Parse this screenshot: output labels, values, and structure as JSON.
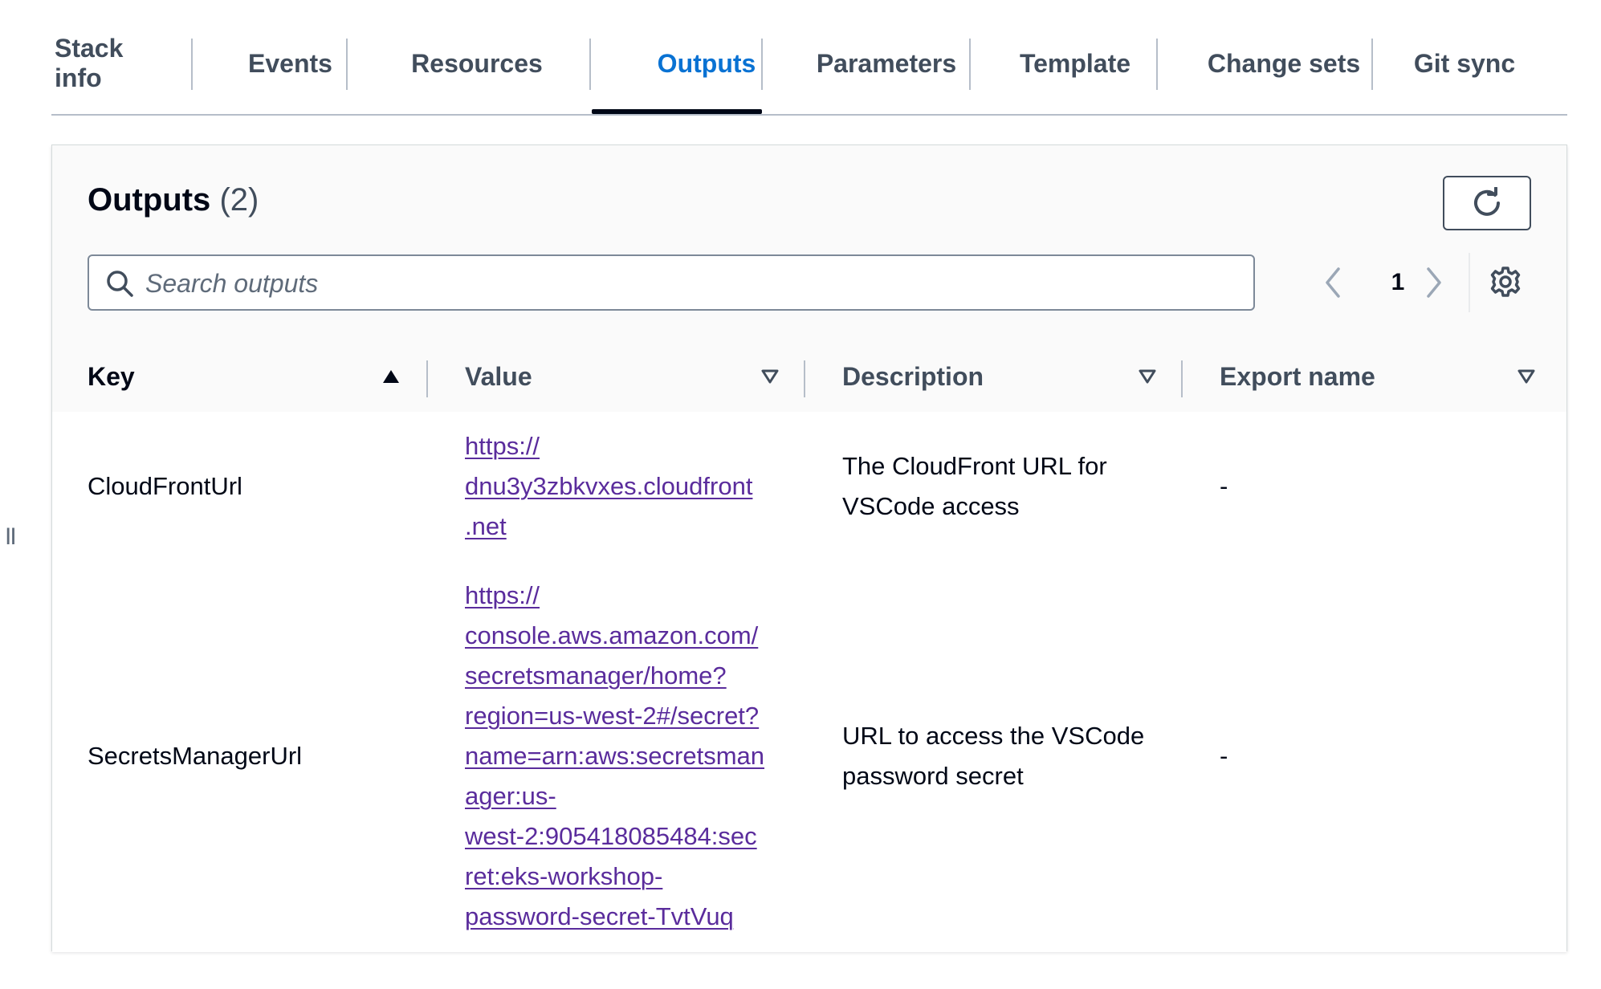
{
  "tabs": [
    {
      "label": "Stack info"
    },
    {
      "label": "Events"
    },
    {
      "label": "Resources"
    },
    {
      "label": "Outputs"
    },
    {
      "label": "Parameters"
    },
    {
      "label": "Template"
    },
    {
      "label": "Change sets"
    },
    {
      "label": "Git sync"
    }
  ],
  "active_tab": "Outputs",
  "panel": {
    "title": "Outputs",
    "count": "(2)",
    "search_placeholder": "Search outputs",
    "search_value": "",
    "page_number": "1"
  },
  "table": {
    "columns": [
      {
        "label": "Key",
        "sort": "ascending"
      },
      {
        "label": "Value",
        "sort": "none"
      },
      {
        "label": "Description",
        "sort": "none"
      },
      {
        "label": "Export name",
        "sort": "none"
      }
    ],
    "rows": [
      {
        "key": "CloudFrontUrl",
        "value": "https://\ndnu3y3zbkvxes.cloudfront\n.net",
        "description": "The CloudFront URL for\nVSCode access",
        "export_name": "-"
      },
      {
        "key": "SecretsManagerUrl",
        "value": "https://\nconsole.aws.amazon.com/\nsecretsmanager/home?\nregion=us-west-2#/secret?\nname=arn:aws:secretsman\nager:us-\nwest-2:905418085484:sec\nret:eks-workshop-\npassword-secret-TvtVuq",
        "description": "URL to access the VSCode\npassword secret",
        "export_name": "-"
      }
    ]
  },
  "side_handle": "II",
  "colors": {
    "active_tab": "#0972d3",
    "link": "#5a2c9c",
    "text": "#000716",
    "muted_text": "#414d5c",
    "border": "#b6bec9"
  },
  "icons": [
    "search-icon",
    "refresh-icon",
    "chevron-left-icon",
    "chevron-right-icon",
    "gear-icon",
    "sort-ascending-icon",
    "sort-descending-outline-icon"
  ]
}
